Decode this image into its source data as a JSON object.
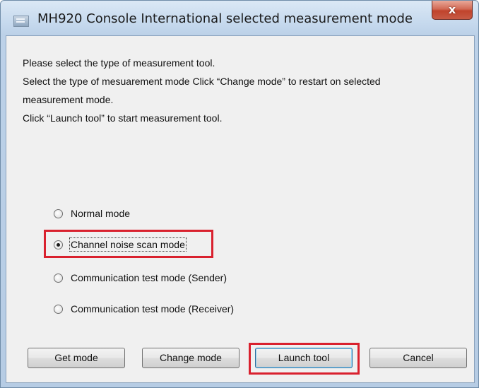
{
  "window": {
    "title": "MH920 Console International selected measurement mode",
    "close_label": "x"
  },
  "instructions": [
    "Please select the type of measurement tool.",
    "Select the type of mesuarement mode Click “Change mode” to restart on selected",
    "measurement mode.",
    "Click “Launch tool” to start  measurement tool."
  ],
  "modes": [
    {
      "label": "Normal mode",
      "selected": false
    },
    {
      "label": "Channel noise scan mode",
      "selected": true
    },
    {
      "label": "Communication test mode (Sender)",
      "selected": false
    },
    {
      "label": "Communication test mode (Receiver)",
      "selected": false
    }
  ],
  "buttons": {
    "get_mode": "Get mode",
    "change_mode": "Change mode",
    "launch_tool": "Launch tool",
    "cancel": "Cancel"
  },
  "colors": {
    "highlight": "#d9212e",
    "close_button": "#c7432c"
  }
}
